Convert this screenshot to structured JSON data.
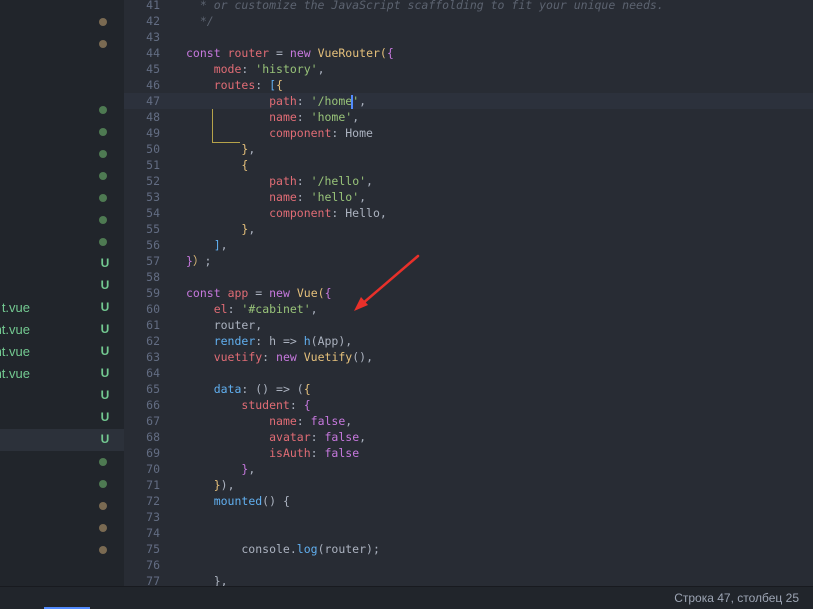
{
  "sidebar": {
    "rows": [
      {
        "kind": "dot",
        "color": "brown"
      },
      {
        "kind": "dot",
        "color": "brown"
      },
      {
        "kind": "empty"
      },
      {
        "kind": "empty"
      },
      {
        "kind": "dot",
        "color": "green"
      },
      {
        "kind": "dot",
        "color": "green"
      },
      {
        "kind": "dot",
        "color": "green"
      },
      {
        "kind": "dot",
        "color": "green"
      },
      {
        "kind": "dot",
        "color": "green"
      },
      {
        "kind": "dot",
        "color": "green"
      },
      {
        "kind": "dot",
        "color": "green"
      },
      {
        "kind": "status",
        "status": "U",
        "name": ""
      },
      {
        "kind": "status",
        "status": "U",
        "name": ""
      },
      {
        "kind": "status",
        "status": "U",
        "name": "t.vue"
      },
      {
        "kind": "status",
        "status": "U",
        "name": "nt.vue"
      },
      {
        "kind": "status",
        "status": "U",
        "name": "ponent.vue"
      },
      {
        "kind": "status",
        "status": "U",
        "name": "nt.vue"
      },
      {
        "kind": "status",
        "status": "U",
        "name": ""
      },
      {
        "kind": "status",
        "status": "U",
        "name": ""
      },
      {
        "kind": "status",
        "status": "U",
        "name": "",
        "selected": true
      },
      {
        "kind": "dot",
        "color": "green"
      },
      {
        "kind": "dot",
        "color": "green"
      },
      {
        "kind": "dot",
        "color": "brown"
      },
      {
        "kind": "dot",
        "color": "brown"
      },
      {
        "kind": "dot",
        "color": "brown"
      }
    ]
  },
  "editor": {
    "first_line": 41,
    "current_line": 47,
    "lines": [
      [
        [
          "cm",
          "  * or customize the JavaScript scaffolding to fit your unique needs."
        ]
      ],
      [
        [
          "cm",
          "  */"
        ]
      ],
      [],
      [
        [
          "kw",
          "const"
        ],
        [
          "pn",
          " "
        ],
        [
          "pr",
          "router"
        ],
        [
          "pn",
          " = "
        ],
        [
          "kw",
          "new"
        ],
        [
          "pn",
          " "
        ],
        [
          "ty",
          "VueRouter"
        ],
        [
          "br",
          "("
        ],
        [
          "br2",
          "{"
        ]
      ],
      [
        [
          "pn",
          "    "
        ],
        [
          "pr",
          "mode"
        ],
        [
          "pn",
          ": "
        ],
        [
          "st",
          "'history'"
        ],
        [
          "pn",
          ","
        ]
      ],
      [
        [
          "pn",
          "    "
        ],
        [
          "pr",
          "routes"
        ],
        [
          "pn",
          ": "
        ],
        [
          "br3",
          "["
        ],
        [
          "br",
          "{"
        ]
      ],
      [
        [
          "pn",
          "            "
        ],
        [
          "pr",
          "path"
        ],
        [
          "pn",
          ": "
        ],
        [
          "st",
          "'/home"
        ],
        [
          "cursor",
          ""
        ],
        [
          "st",
          "'"
        ],
        [
          "pn",
          ","
        ]
      ],
      [
        [
          "pn",
          "            "
        ],
        [
          "pr",
          "name"
        ],
        [
          "pn",
          ": "
        ],
        [
          "st",
          "'home'"
        ],
        [
          "pn",
          ","
        ]
      ],
      [
        [
          "pn",
          "            "
        ],
        [
          "pr",
          "component"
        ],
        [
          "pn",
          ": Home"
        ]
      ],
      [
        [
          "pn",
          "        "
        ],
        [
          "br",
          "}"
        ],
        [
          "pn",
          ","
        ]
      ],
      [
        [
          "pn",
          "        "
        ],
        [
          "br",
          "{"
        ]
      ],
      [
        [
          "pn",
          "            "
        ],
        [
          "pr",
          "path"
        ],
        [
          "pn",
          ": "
        ],
        [
          "st",
          "'/hello'"
        ],
        [
          "pn",
          ","
        ]
      ],
      [
        [
          "pn",
          "            "
        ],
        [
          "pr",
          "name"
        ],
        [
          "pn",
          ": "
        ],
        [
          "st",
          "'hello'"
        ],
        [
          "pn",
          ","
        ]
      ],
      [
        [
          "pn",
          "            "
        ],
        [
          "pr",
          "component"
        ],
        [
          "pn",
          ": Hello,"
        ]
      ],
      [
        [
          "pn",
          "        "
        ],
        [
          "br",
          "}"
        ],
        [
          "pn",
          ","
        ]
      ],
      [
        [
          "pn",
          "    "
        ],
        [
          "br3",
          "]"
        ],
        [
          "pn",
          ","
        ]
      ],
      [
        [
          "br2",
          "}"
        ],
        [
          "br",
          "）"
        ],
        [
          "pn",
          ";"
        ]
      ],
      [],
      [
        [
          "kw",
          "const"
        ],
        [
          "pn",
          " "
        ],
        [
          "pr",
          "app"
        ],
        [
          "pn",
          " = "
        ],
        [
          "kw",
          "new"
        ],
        [
          "pn",
          " "
        ],
        [
          "ty",
          "Vue"
        ],
        [
          "br",
          "("
        ],
        [
          "br2",
          "{"
        ]
      ],
      [
        [
          "pn",
          "    "
        ],
        [
          "pr",
          "el"
        ],
        [
          "pn",
          ": "
        ],
        [
          "st",
          "'#cabinet'"
        ],
        [
          "pn",
          ","
        ]
      ],
      [
        [
          "pn",
          "    router,"
        ]
      ],
      [
        [
          "pn",
          "    "
        ],
        [
          "fn",
          "render"
        ],
        [
          "pn",
          ": h => "
        ],
        [
          "fn",
          "h"
        ],
        [
          "pn",
          "(App),"
        ]
      ],
      [
        [
          "pn",
          "    "
        ],
        [
          "pr",
          "vuetify"
        ],
        [
          "pn",
          ": "
        ],
        [
          "kw",
          "new"
        ],
        [
          "pn",
          " "
        ],
        [
          "ty",
          "Vuetify"
        ],
        [
          "pn",
          "(),"
        ]
      ],
      [],
      [
        [
          "pn",
          "    "
        ],
        [
          "fn",
          "data"
        ],
        [
          "pn",
          ": () => ("
        ],
        [
          "br",
          "{"
        ]
      ],
      [
        [
          "pn",
          "        "
        ],
        [
          "pr",
          "student"
        ],
        [
          "pn",
          ": "
        ],
        [
          "br2",
          "{"
        ]
      ],
      [
        [
          "pn",
          "            "
        ],
        [
          "pr",
          "name"
        ],
        [
          "pn",
          ": "
        ],
        [
          "kw",
          "false"
        ],
        [
          "pn",
          ","
        ]
      ],
      [
        [
          "pn",
          "            "
        ],
        [
          "pr",
          "avatar"
        ],
        [
          "pn",
          ": "
        ],
        [
          "kw",
          "false"
        ],
        [
          "pn",
          ","
        ]
      ],
      [
        [
          "pn",
          "            "
        ],
        [
          "pr",
          "isAuth"
        ],
        [
          "pn",
          ": "
        ],
        [
          "kw",
          "false"
        ]
      ],
      [
        [
          "pn",
          "        "
        ],
        [
          "br2",
          "}"
        ],
        [
          "pn",
          ","
        ]
      ],
      [
        [
          "pn",
          "    "
        ],
        [
          "br",
          "}"
        ],
        [
          "pn",
          "),"
        ]
      ],
      [
        [
          "pn",
          "    "
        ],
        [
          "fn",
          "mounted"
        ],
        [
          "pn",
          "() {"
        ]
      ],
      [],
      [],
      [
        [
          "pn",
          "        console."
        ],
        [
          "fn",
          "log"
        ],
        [
          "pn",
          "(router);"
        ]
      ],
      [],
      [
        [
          "pn",
          "    },"
        ]
      ]
    ]
  },
  "statusbar": {
    "cursor_position": "Строка 47, столбец 25"
  },
  "colors": {
    "background": "#282c34",
    "sidebar_bg": "#21252b",
    "git_untracked": "#73c991",
    "annotation_arrow": "#e8302a"
  }
}
